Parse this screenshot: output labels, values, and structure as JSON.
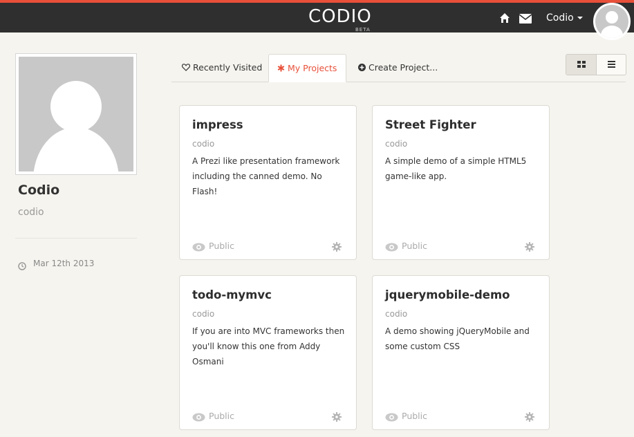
{
  "header": {
    "logo": "CODIO",
    "logo_badge": "BETA",
    "user_menu_label": "Codio",
    "accent_color": "#e8503a"
  },
  "icons": {
    "home": "home-icon",
    "mail": "mail-icon",
    "avatar": "user-avatar",
    "heart": "heart-icon",
    "asterisk": "asterisk-icon",
    "plus": "plus-circle-icon",
    "grid": "grid-icon",
    "list": "list-icon",
    "eye": "eye-icon",
    "gear": "gear-icon",
    "clock": "clock-icon"
  },
  "profile": {
    "name": "Codio",
    "username": "codio",
    "joined": "Mar 12th 2013"
  },
  "tabs": [
    {
      "label": "Recently Visited"
    },
    {
      "label": "My Projects",
      "active": true
    },
    {
      "label": "Create Project..."
    }
  ],
  "projects": [
    {
      "title": "impress",
      "owner": "codio",
      "description": "A Prezi like presentation framework including the canned demo. No Flash!",
      "visibility": "Public"
    },
    {
      "title": "Street Fighter",
      "owner": "codio",
      "description": "A simple demo of a simple HTML5 game-like app.",
      "visibility": "Public"
    },
    {
      "title": "todo-mymvc",
      "owner": "codio",
      "description": "If you are into MVC frameworks then you'll know this one from Addy Osmani",
      "visibility": "Public"
    },
    {
      "title": "jquerymobile-demo",
      "owner": "codio",
      "description": "A demo showing jQueryMobile and some custom CSS",
      "visibility": "Public"
    }
  ]
}
